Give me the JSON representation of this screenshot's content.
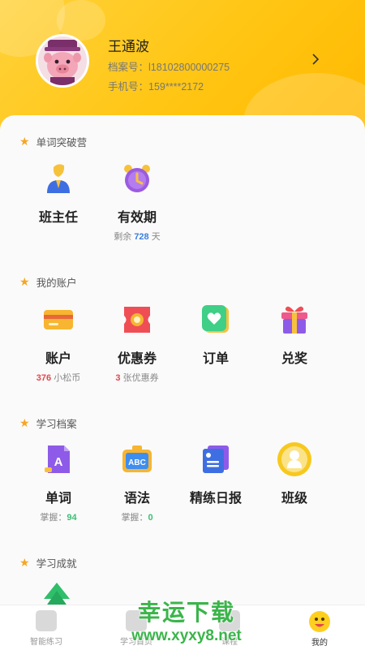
{
  "profile": {
    "name": "王通波",
    "archive_label": "档案号：",
    "archive_no": "l18102800000275",
    "phone_label": "手机号：",
    "phone": "159****2172"
  },
  "sections": {
    "camp": {
      "title": "单词突破营",
      "items": [
        {
          "label": "班主任",
          "icon": "teacher-icon"
        },
        {
          "label": "有效期",
          "icon": "alarm-clock-icon",
          "sub_prefix": "剩余 ",
          "sub_value": "728",
          "sub_suffix": " 天"
        }
      ]
    },
    "account": {
      "title": "我的账户",
      "items": [
        {
          "label": "账户",
          "icon": "wallet-card-icon",
          "sub_value": "376",
          "sub_suffix": " 小松币"
        },
        {
          "label": "优惠券",
          "icon": "coupon-icon",
          "sub_value": "3",
          "sub_suffix": " 张优惠券"
        },
        {
          "label": "订单",
          "icon": "order-heart-icon"
        },
        {
          "label": "兑奖",
          "icon": "gift-box-icon"
        }
      ]
    },
    "study": {
      "title": "学习档案",
      "items": [
        {
          "label": "单词",
          "icon": "word-doc-icon",
          "sub_prefix": "掌握：",
          "sub_value": "94"
        },
        {
          "label": "语法",
          "icon": "abc-board-icon",
          "sub_prefix": "掌握：",
          "sub_value": "0"
        },
        {
          "label": "精练日报",
          "icon": "daily-report-icon"
        },
        {
          "label": "班级",
          "icon": "class-badge-icon"
        }
      ]
    },
    "achievement": {
      "title": "学习成就"
    }
  },
  "tabs": [
    {
      "label": "智能练习",
      "icon": "practice-icon"
    },
    {
      "label": "学习首页",
      "icon": "study-home-icon"
    },
    {
      "label": "课程",
      "icon": "course-icon"
    },
    {
      "label": "我的",
      "icon": "my-face-icon"
    }
  ],
  "watermark": {
    "line1": "幸运下载",
    "line2": "www.xyxy8.net"
  },
  "colors": {
    "header": "#ffc512",
    "accent_blue": "#3b7fe0",
    "accent_red": "#e3474f",
    "accent_green": "#3cbf74",
    "star": "#f5a623"
  }
}
